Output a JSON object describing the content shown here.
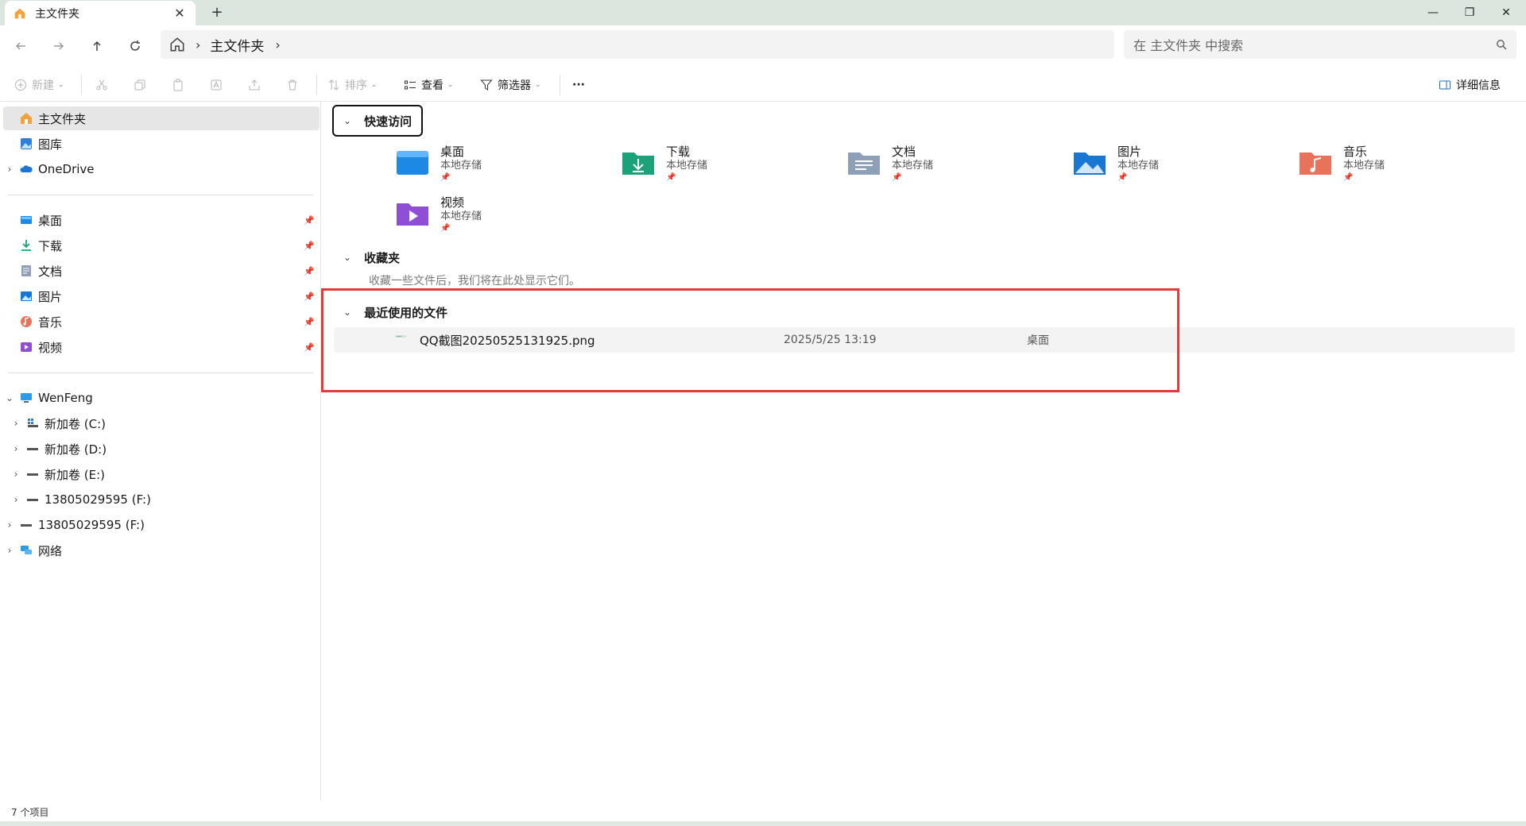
{
  "window": {
    "tab_title": "主文件夹",
    "tab_close": "✕",
    "new_tab": "+",
    "minimize": "—",
    "maximize": "❐",
    "close": "✕"
  },
  "address": {
    "breadcrumb": [
      "主文件夹"
    ],
    "search_placeholder": "在 主文件夹 中搜索"
  },
  "toolbar": {
    "new_label": "新建",
    "sort_label": "排序",
    "view_label": "查看",
    "filter_label": "筛选器",
    "more_label": "···",
    "details_label": "详细信息"
  },
  "sidebar": {
    "top": [
      {
        "label": "主文件夹",
        "icon": "home-icon"
      },
      {
        "label": "图库",
        "icon": "gallery-icon"
      },
      {
        "label": "OneDrive",
        "icon": "cloud-icon"
      }
    ],
    "pinned": [
      {
        "label": "桌面",
        "icon": "desktop-icon"
      },
      {
        "label": "下载",
        "icon": "download-icon"
      },
      {
        "label": "文档",
        "icon": "document-icon"
      },
      {
        "label": "图片",
        "icon": "pictures-icon"
      },
      {
        "label": "音乐",
        "icon": "music-icon"
      },
      {
        "label": "视频",
        "icon": "video-icon"
      }
    ],
    "pin_glyph": "📌",
    "pc": {
      "label": "WenFeng",
      "drives": [
        "新加卷 (C:)",
        "新加卷 (D:)",
        "新加卷 (E:)",
        "13805029595 (F:)"
      ]
    },
    "extra": [
      "13805029595 (F:)",
      "网络"
    ]
  },
  "quick_access": {
    "title": "快速访问",
    "items": [
      {
        "name": "桌面",
        "sub": "本地存储",
        "color": "#1e88e5",
        "icon": "desktop-folder-icon"
      },
      {
        "name": "下载",
        "sub": "本地存储",
        "color": "#1aa37a",
        "icon": "download-folder-icon"
      },
      {
        "name": "文档",
        "sub": "本地存储",
        "color": "#8ea0b8",
        "icon": "document-folder-icon"
      },
      {
        "name": "图片",
        "sub": "本地存储",
        "color": "#1976d2",
        "icon": "pictures-folder-icon"
      },
      {
        "name": "音乐",
        "sub": "本地存储",
        "color": "#e8735a",
        "icon": "music-folder-icon"
      },
      {
        "name": "视频",
        "sub": "本地存储",
        "color": "#8e4fd6",
        "icon": "video-folder-icon"
      }
    ]
  },
  "favorites": {
    "title": "收藏夹",
    "hint": "收藏一些文件后，我们将在此处显示它们。"
  },
  "recent": {
    "title": "最近使用的文件",
    "files": [
      {
        "name": "QQ截图20250525131925.png",
        "date": "2025/5/25 13:19",
        "location": "桌面"
      }
    ]
  },
  "status": {
    "count": "7 个项目"
  }
}
